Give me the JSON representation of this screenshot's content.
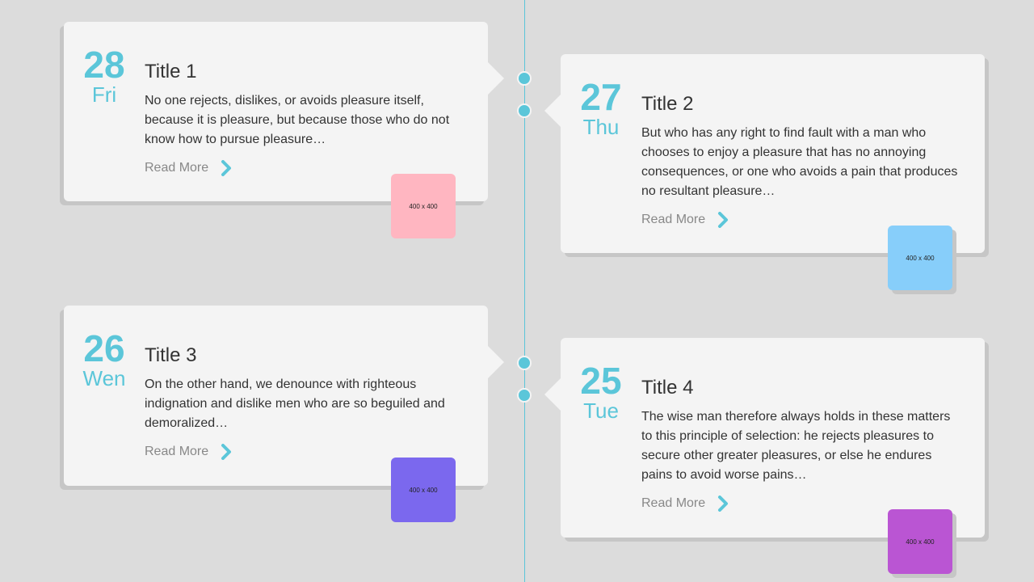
{
  "entries": [
    {
      "day": "28",
      "weekday": "Fri",
      "title": "Title 1",
      "text": "No one rejects, dislikes, or avoids pleasure itself, because it is pleasure, but because those who do not know how to pursue pleasure…",
      "read_more": "Read More",
      "thumb_label": "400 x 400",
      "thumb_color": "#ffb6c1"
    },
    {
      "day": "27",
      "weekday": "Thu",
      "title": "Title 2",
      "text": "But who has any right to find fault with a man who chooses to enjoy a pleasure that has no annoying consequences, or one who avoids a pain that produces no resultant pleasure…",
      "read_more": "Read More",
      "thumb_label": "400 x 400",
      "thumb_color": "#87cefa"
    },
    {
      "day": "26",
      "weekday": "Wen",
      "title": "Title 3",
      "text": "On the other hand, we denounce with righteous indignation and dislike men who are so beguiled and demoralized…",
      "read_more": "Read More",
      "thumb_label": "400 x 400",
      "thumb_color": "#7b68ee"
    },
    {
      "day": "25",
      "weekday": "Tue",
      "title": "Title 4",
      "text": "The wise man therefore always holds in these matters to this principle of selection: he rejects pleasures to secure other greater pleasures, or else he endures pains to avoid worse pains…",
      "read_more": "Read More",
      "thumb_label": "400 x 400",
      "thumb_color": "#ba55d3"
    }
  ],
  "colors": {
    "accent": "#5bc6d9",
    "background": "#dcdcdc",
    "card": "#f4f4f4"
  },
  "icons": {
    "read_more": "chevron-right-icon"
  }
}
